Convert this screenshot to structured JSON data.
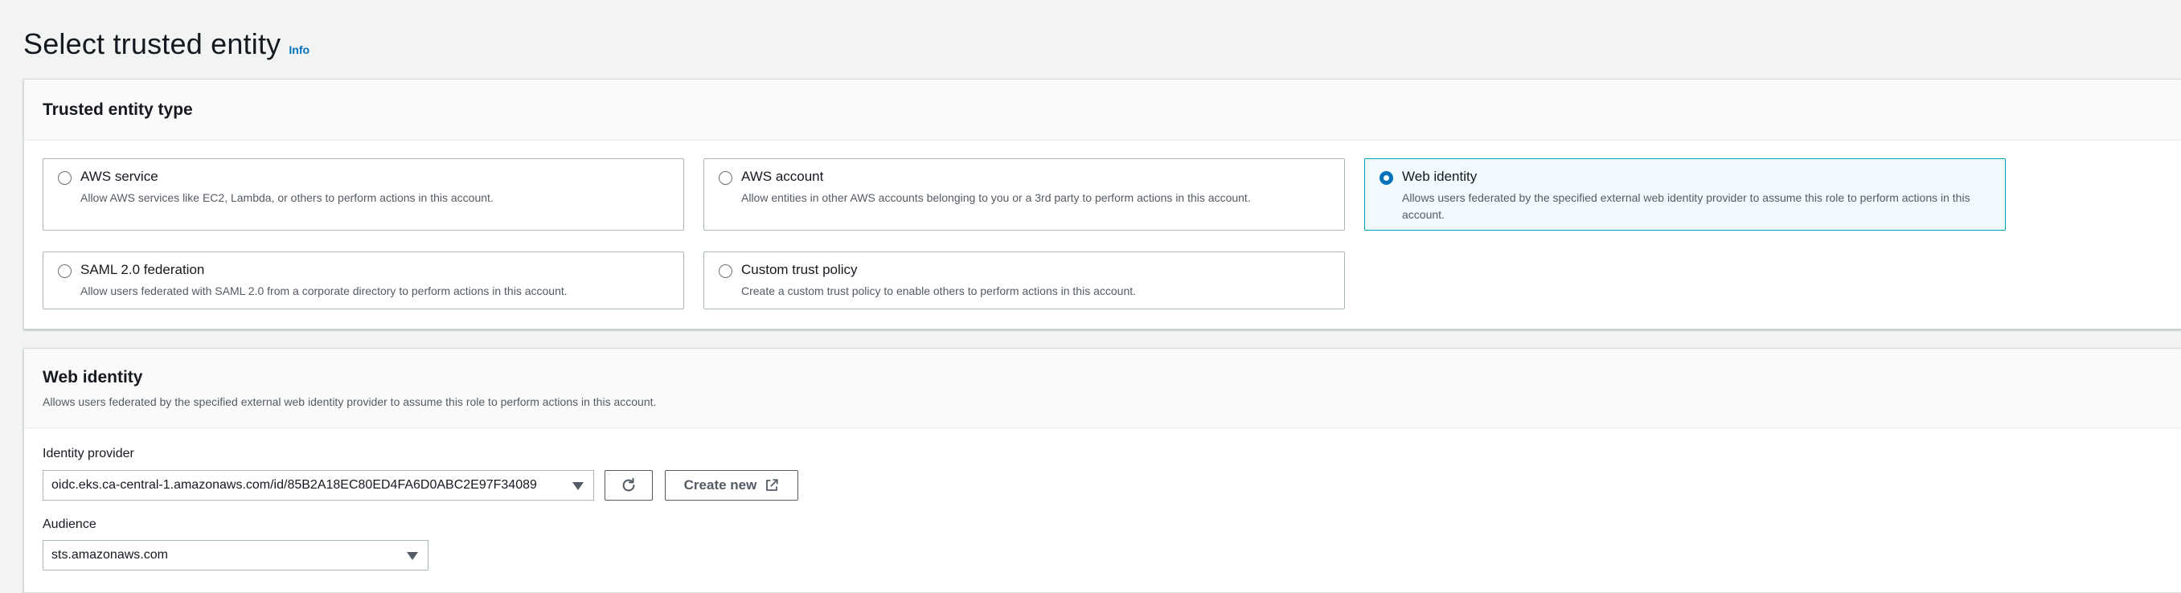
{
  "header": {
    "title": "Select trusted entity",
    "info_label": "Info"
  },
  "entity_section": {
    "title": "Trusted entity type",
    "options": [
      {
        "label": "AWS service",
        "description": "Allow AWS services like EC2, Lambda, or others to perform actions in this account.",
        "selected": false
      },
      {
        "label": "AWS account",
        "description": "Allow entities in other AWS accounts belonging to you or a 3rd party to perform actions in this account.",
        "selected": false
      },
      {
        "label": "Web identity",
        "description": "Allows users federated by the specified external web identity provider to assume this role to perform actions in this account.",
        "selected": true
      },
      {
        "label": "SAML 2.0 federation",
        "description": "Allow users federated with SAML 2.0 from a corporate directory to perform actions in this account.",
        "selected": false
      },
      {
        "label": "Custom trust policy",
        "description": "Create a custom trust policy to enable others to perform actions in this account.",
        "selected": false
      }
    ]
  },
  "web_identity": {
    "title": "Web identity",
    "description": "Allows users federated by the specified external web identity provider to assume this role to perform actions in this account.",
    "identity_provider_label": "Identity provider",
    "identity_provider_value": "oidc.eks.ca-central-1.amazonaws.com/id/85B2A18EC80ED4FA6D0ABC2E97F34089",
    "refresh_icon": "refresh-icon",
    "create_new_label": "Create new",
    "external_icon": "external-link-icon",
    "audience_label": "Audience",
    "audience_value": "sts.amazonaws.com"
  },
  "colors": {
    "accent": "#0073bb",
    "selected_bg": "#f1faff",
    "selected_border": "#00a1c9"
  }
}
